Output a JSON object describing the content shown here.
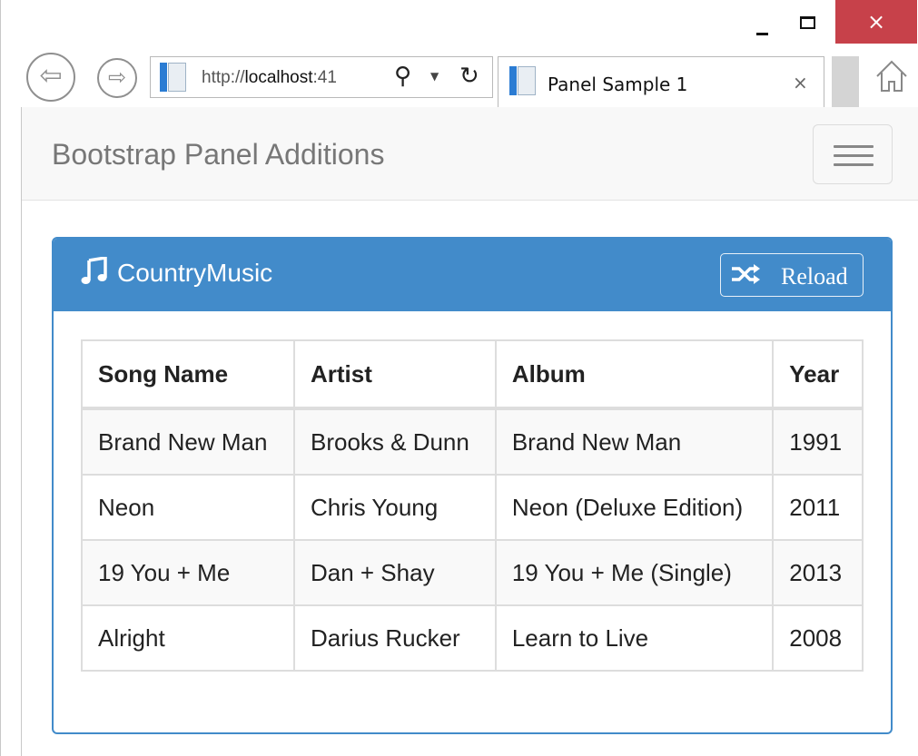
{
  "window": {
    "close_glyph": "×"
  },
  "browser": {
    "address_prefix": "http://",
    "address_host": "localhost",
    "address_port": ":41",
    "tab_title": "Panel Sample 1",
    "tab_close_glyph": "×"
  },
  "navbar": {
    "brand": "Bootstrap Panel Additions"
  },
  "panel": {
    "title": "CountryMusic",
    "reload_label": "Reload",
    "accent_color": "#428bca"
  },
  "table": {
    "headers": [
      "Song Name",
      "Artist",
      "Album",
      "Year"
    ],
    "rows": [
      [
        "Brand New Man",
        "Brooks & Dunn",
        "Brand New Man",
        "1991"
      ],
      [
        "Neon",
        "Chris Young",
        "Neon (Deluxe Edition)",
        "2011"
      ],
      [
        "19 You + Me",
        "Dan + Shay",
        "19 You + Me (Single)",
        "2013"
      ],
      [
        "Alright",
        "Darius Rucker",
        "Learn to Live",
        "2008"
      ]
    ]
  },
  "icons": {
    "back": "back-arrow-icon",
    "forward": "forward-arrow-icon",
    "search": "search-icon",
    "refresh": "refresh-icon",
    "home": "home-icon",
    "music": "music-note-icon",
    "shuffle": "shuffle-icon",
    "menu": "hamburger-icon"
  }
}
